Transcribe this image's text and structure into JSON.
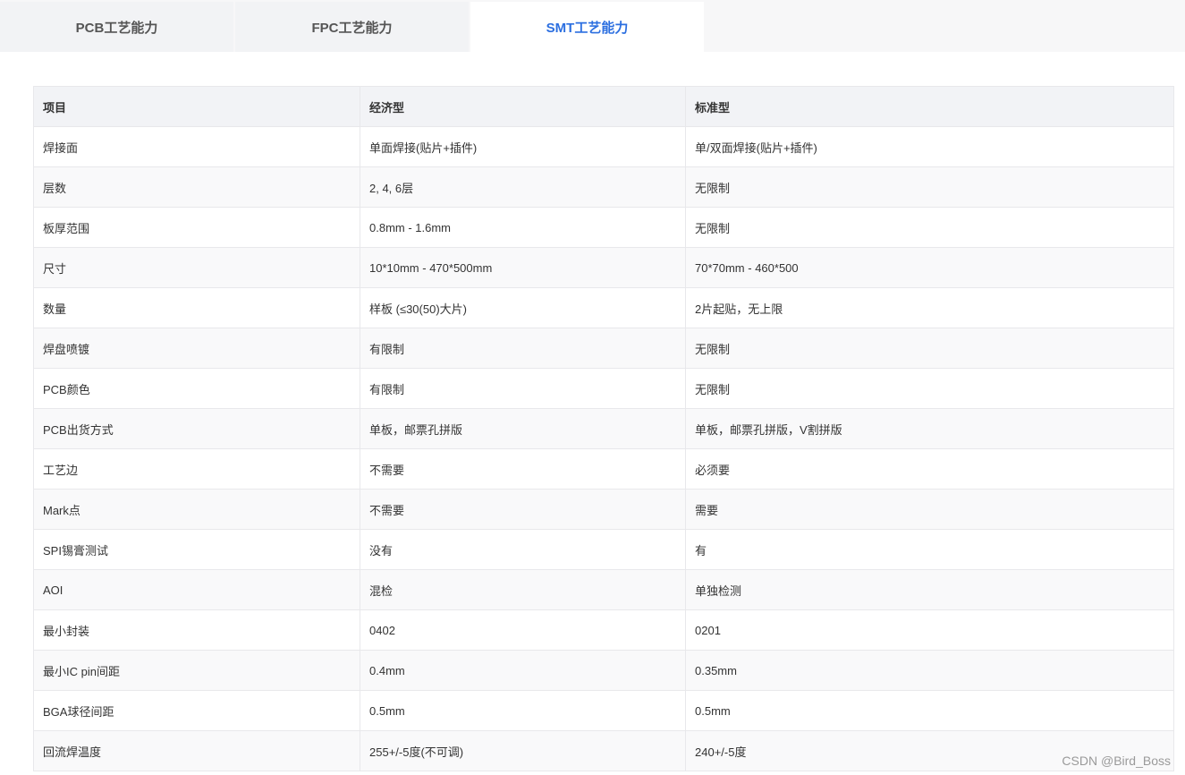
{
  "tabs": [
    {
      "label": "PCB工艺能力"
    },
    {
      "label": "FPC工艺能力"
    },
    {
      "label": "SMT工艺能力"
    }
  ],
  "table": {
    "headers": [
      "项目",
      "经济型",
      "标准型"
    ],
    "rows": [
      [
        "焊接面",
        "单面焊接(贴片+插件)",
        "单/双面焊接(贴片+插件)"
      ],
      [
        "层数",
        "2, 4, 6层",
        "无限制"
      ],
      [
        "板厚范围",
        "0.8mm - 1.6mm",
        "无限制"
      ],
      [
        "尺寸",
        "10*10mm - 470*500mm",
        "70*70mm - 460*500"
      ],
      [
        "数量",
        "样板 (≤30(50)大片)",
        "2片起贴，无上限"
      ],
      [
        "焊盘喷镀",
        "有限制",
        "无限制"
      ],
      [
        "PCB颜色",
        "有限制",
        "无限制"
      ],
      [
        "PCB出货方式",
        "单板，邮票孔拼版",
        "单板，邮票孔拼版，V割拼版"
      ],
      [
        "工艺边",
        "不需要",
        "必须要"
      ],
      [
        "Mark点",
        "不需要",
        "需要"
      ],
      [
        "SPI锡膏测试",
        "没有",
        "有"
      ],
      [
        "AOI",
        "混检",
        "单独检测"
      ],
      [
        "最小封装",
        "0402",
        "0201"
      ],
      [
        "最小IC pin间距",
        "0.4mm",
        "0.35mm"
      ],
      [
        "BGA球径间距",
        "0.5mm",
        "0.5mm"
      ],
      [
        "回流焊温度",
        "255+/-5度(不可调)",
        "240+/-5度"
      ]
    ]
  },
  "watermark": "CSDN @Bird_Boss",
  "colors": {
    "active_tab": "#2c6fe0",
    "header_bg": "#f2f3f6",
    "tab_bg": "#f2f3f5"
  }
}
